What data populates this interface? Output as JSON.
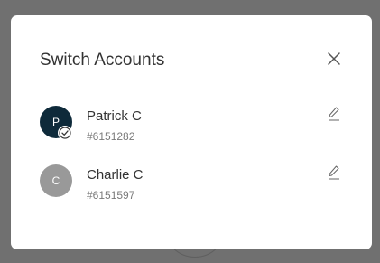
{
  "modal": {
    "title": "Switch Accounts",
    "close_icon": "close-icon"
  },
  "accounts": [
    {
      "initial": "P",
      "name": "Patrick C",
      "id": "#6151282",
      "avatar_color": "#0e2a3a",
      "active": true,
      "badge_icon": "check-circle-icon",
      "edit_icon": "pencil-icon"
    },
    {
      "initial": "C",
      "name": "Charlie C",
      "id": "#6151597",
      "avatar_color": "#999999",
      "active": false,
      "edit_icon": "pencil-icon"
    }
  ],
  "colors": {
    "overlay": "#707070",
    "modal_background": "#ffffff",
    "title_text": "#333333",
    "secondary_text": "#7a7a7a"
  }
}
